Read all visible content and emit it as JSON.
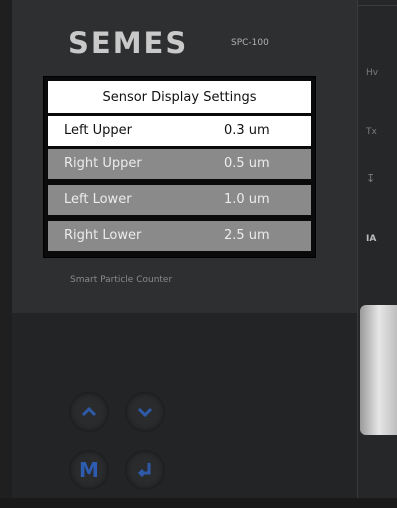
{
  "device": {
    "brand": "SEMES",
    "model": "SPC-100",
    "subtitle": "Smart Particle Counter"
  },
  "screen": {
    "title": "Sensor Display Settings",
    "rows": [
      {
        "name": "Left Upper",
        "value": "0.3 um",
        "selected": true
      },
      {
        "name": "Right Upper",
        "value": "0.5 um",
        "selected": false
      },
      {
        "name": "Left Lower",
        "value": "1.0 um",
        "selected": false
      },
      {
        "name": "Right Lower",
        "value": "2.5 um",
        "selected": false
      }
    ]
  },
  "keypad": {
    "up": "chevron-up-icon",
    "down": "chevron-down-icon",
    "menu": "M",
    "enter": "enter-icon"
  },
  "side_labels": [
    "Hv",
    "Tx",
    "IA"
  ],
  "colors": {
    "button_icon": "#2f5aa8",
    "row_selected": "#ffffff",
    "row_normal": "#8a8a8a",
    "panel": "#2e2f31"
  }
}
